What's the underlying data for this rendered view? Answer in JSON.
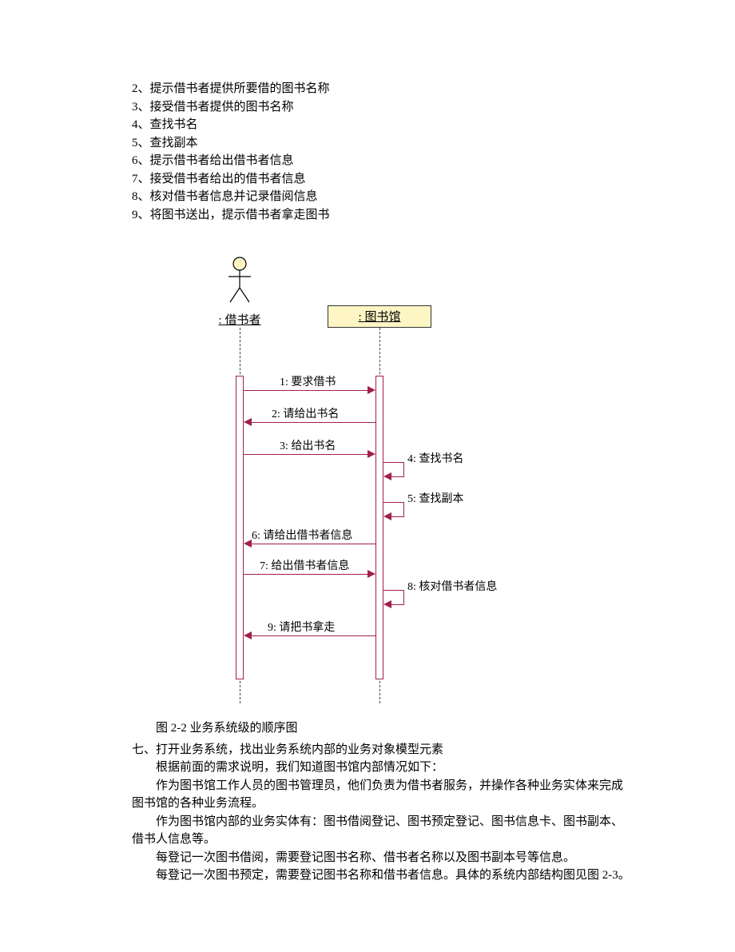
{
  "steps": [
    "2、提示借书者提供所要借的图书名称",
    "3、接受借书者提供的图书名称",
    "4、查找书名",
    "5、查找副本",
    "6、提示借书者给出借书者信息",
    "7、接受借书者给出的借书者信息",
    "8、核对借书者信息并记录借阅信息",
    "9、将图书送出，提示借书者拿走图书"
  ],
  "diagram": {
    "actor_label": " : 借书者",
    "object_label": " : 图书馆",
    "messages": {
      "m1": "1: 要求借书",
      "m2": "2: 请给出书名",
      "m3": "3: 给出书名",
      "m4": "4: 查找书名",
      "m5": "5: 查找副本",
      "m6": "6: 请给出借书者信息",
      "m7": "7: 给出借书者信息",
      "m8": "8: 核对借书者信息",
      "m9": "9: 请把书拿走"
    }
  },
  "caption": "图 2-2 业务系统级的顺序图",
  "section_heading": "七、打开业务系统，找出业务系统内部的业务对象模型元素",
  "paragraphs": {
    "p1": "根据前面的需求说明，我们知道图书馆内部情况如下：",
    "p2": "作为图书馆工作人员的图书管理员，他们负责为借书者服务，并操作各种业务实体来完成图书馆的各种业务流程。",
    "p3": "作为图书馆内部的业务实体有：图书借阅登记、图书预定登记、图书信息卡、图书副本、借书人信息等。",
    "p4": "每登记一次图书借阅，需要登记图书名称、借书者名称以及图书副本号等信息。",
    "p5": "每登记一次图书预定，需要登记图书名称和借书者信息。具体的系统内部结构图见图 2-3。"
  }
}
